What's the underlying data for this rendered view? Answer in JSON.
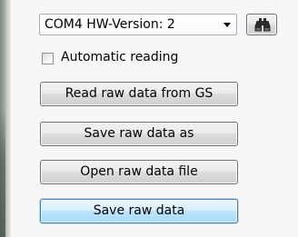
{
  "port_selector": {
    "selected_value": "COM4 HW-Version: 2",
    "dropdown_icon": "chevron-down-icon"
  },
  "find_button": {
    "icon": "binoculars-icon"
  },
  "automatic_reading": {
    "label": "Automatic reading",
    "checked": false
  },
  "buttons": {
    "read_raw_data": "Read raw data from GS",
    "save_raw_data_as": "Save raw data as",
    "open_raw_data_file": "Open raw data file",
    "save_raw_data": "Save raw data"
  },
  "colors": {
    "panel_background": "#f7f7f7",
    "button_border": "#707070",
    "focused_button_border": "#3c7fb1",
    "focused_button_fill": "#bee6fd"
  }
}
